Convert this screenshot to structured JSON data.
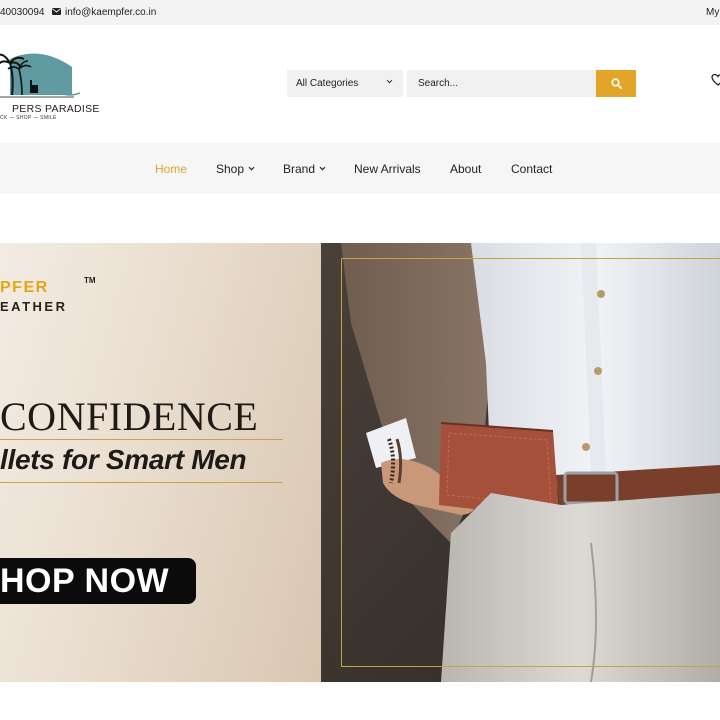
{
  "topbar": {
    "phone": "40030094",
    "email": "info@kaempfer.co.in",
    "account": "My"
  },
  "logo": {
    "name": "PERS PARADISE",
    "tagline": "CK — SHOP — SMILE"
  },
  "search": {
    "category": "All Categories",
    "placeholder": "Search..."
  },
  "nav": {
    "items": [
      {
        "label": "Home",
        "active": true
      },
      {
        "label": "Shop",
        "dropdown": true
      },
      {
        "label": "Brand",
        "dropdown": true
      },
      {
        "label": "New Arrivals"
      },
      {
        "label": "About"
      },
      {
        "label": "Contact"
      }
    ]
  },
  "hero": {
    "brand_top": "PFER",
    "brand_tm": "TM",
    "brand_bottom": "EATHER",
    "title": "CONFIDENCE",
    "subtitle": "llets for Smart Men",
    "cta": "HOP NOW"
  },
  "colors": {
    "accent": "#e2a52a",
    "nav_bg": "#f6f6f6",
    "topbar_bg": "#f3f3f3"
  },
  "icons": {
    "email": "envelope-icon",
    "search": "search-icon",
    "wishlist": "heart-icon",
    "dropdown": "chevron-down-icon"
  }
}
